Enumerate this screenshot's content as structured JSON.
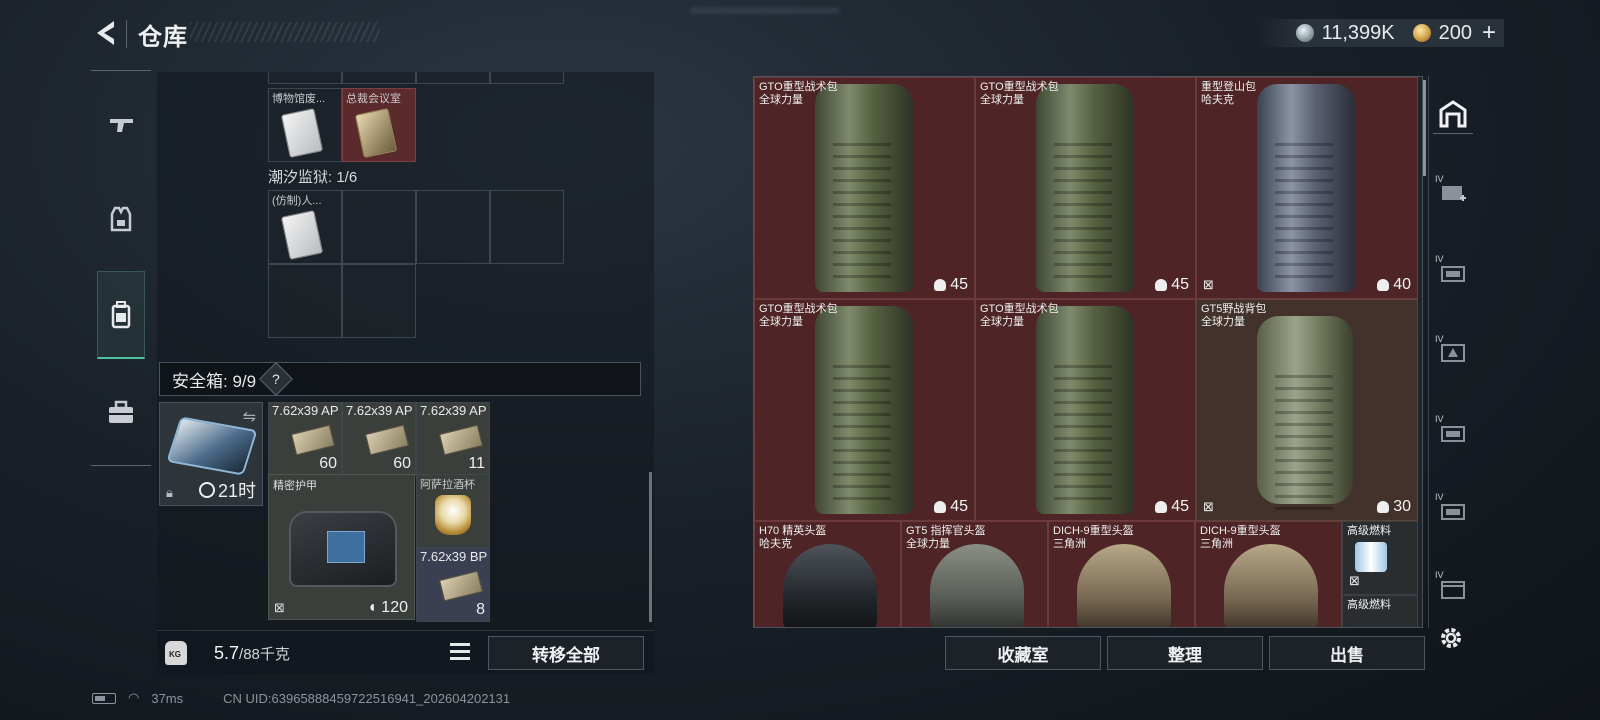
{
  "header": {
    "title": "仓库"
  },
  "currency": {
    "silver": "11,399K",
    "gold": "200",
    "plus": "+"
  },
  "left_nav": {
    "items": [
      {
        "icon": "pistol-icon"
      },
      {
        "icon": "vest-icon"
      },
      {
        "icon": "backpack-icon",
        "selected": true
      },
      {
        "icon": "toolbox-icon"
      }
    ]
  },
  "loot": {
    "top_items": [
      {
        "label": "博物馆废...",
        "kind": "card-white"
      },
      {
        "label": "总裁会议室",
        "kind": "card-gold"
      }
    ],
    "tide_prison_label": "潮汐监狱: 1/6",
    "tide_item": {
      "label": "(仿制)人..."
    }
  },
  "safebox": {
    "label": "安全箱: 9/9",
    "help": "?",
    "timer": "21时",
    "items": {
      "ammo1": {
        "name": "7.62x39 AP",
        "count": "60"
      },
      "ammo2": {
        "name": "7.62x39 AP",
        "count": "60"
      },
      "ammo3": {
        "name": "7.62x39 AP",
        "count": "11"
      },
      "armor": {
        "name": "精密护甲",
        "value": "120"
      },
      "cup": {
        "name": "阿萨拉酒杯"
      },
      "ammo4": {
        "name": "7.62x39 BP",
        "count": "8"
      }
    }
  },
  "weight": {
    "value": "5.7",
    "max": "/88千克"
  },
  "buttons": {
    "transfer_all": "转移全部",
    "collection": "收藏室",
    "organize": "整理",
    "sell": "出售"
  },
  "status": {
    "ping": "37ms",
    "uid": "CN UID:63965888459722516941_202604202131"
  },
  "storage": [
    {
      "name": "GTO重型战术包",
      "brand": "全球力量",
      "count": "45"
    },
    {
      "name": "GTO重型战术包",
      "brand": "全球力量",
      "count": "45"
    },
    {
      "name": "重型登山包",
      "brand": "哈夫克",
      "count": "40"
    },
    {
      "name": "GTO重型战术包",
      "brand": "全球力量",
      "count": "45"
    },
    {
      "name": "GTO重型战术包",
      "brand": "全球力量",
      "count": "45"
    },
    {
      "name": "GT5野战背包",
      "brand": "全球力量",
      "count": "30"
    },
    {
      "name": "H70 精英头盔",
      "brand": "哈夫克"
    },
    {
      "name": "GT5 指挥官头盔",
      "brand": "全球力量"
    },
    {
      "name": "DICH-9重型头盔",
      "brand": "三角洲"
    },
    {
      "name": "DICH-9重型头盔",
      "brand": "三角洲"
    },
    {
      "name": "高级燃料"
    },
    {
      "name": "高级燃料"
    }
  ],
  "right_nav": {
    "tier_label": "IV"
  }
}
